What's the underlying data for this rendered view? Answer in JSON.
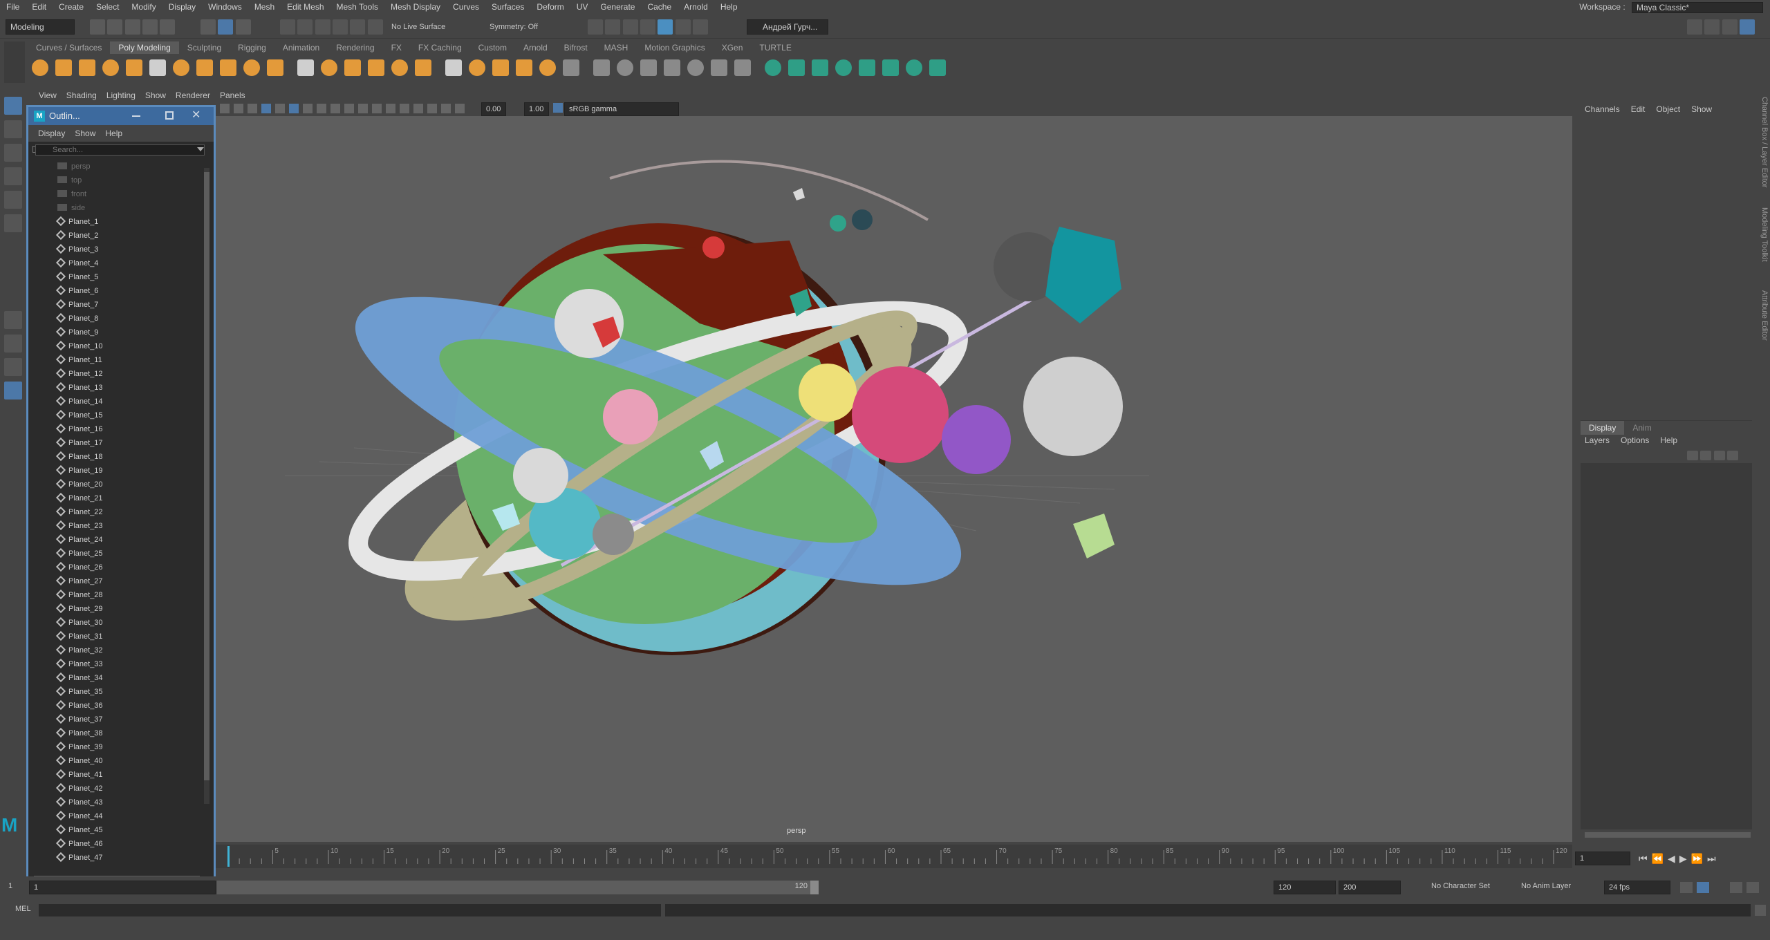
{
  "menubar": {
    "items": [
      "File",
      "Edit",
      "Create",
      "Select",
      "Modify",
      "Display",
      "Windows",
      "Mesh",
      "Edit Mesh",
      "Mesh Tools",
      "Mesh Display",
      "Curves",
      "Surfaces",
      "Deform",
      "UV",
      "Generate",
      "Cache",
      "Arnold",
      "Help"
    ],
    "workspace_label": "Workspace :",
    "workspace_value": "Maya Classic*"
  },
  "statusline": {
    "menuset": "Modeling",
    "live_surface": "No Live Surface",
    "symmetry": "Symmetry: Off",
    "user": "Андрей Гурч..."
  },
  "shelf": {
    "tabs": [
      "Curves / Surfaces",
      "Poly Modeling",
      "Sculpting",
      "Rigging",
      "Animation",
      "Rendering",
      "FX",
      "FX Caching",
      "Custom",
      "Arnold",
      "Bifrost",
      "MASH",
      "Motion Graphics",
      "XGen",
      "TURTLE"
    ],
    "active_tab": "Poly Modeling"
  },
  "outliner": {
    "title": "Outlin...",
    "menu": [
      "Display",
      "Show",
      "Help"
    ],
    "search_placeholder": "Search...",
    "cameras": [
      "persp",
      "top",
      "front",
      "side"
    ],
    "items": [
      "Planet_1",
      "Planet_2",
      "Planet_3",
      "Planet_4",
      "Planet_5",
      "Planet_6",
      "Planet_7",
      "Planet_8",
      "Planet_9",
      "Planet_10",
      "Planet_11",
      "Planet_12",
      "Planet_13",
      "Planet_14",
      "Planet_15",
      "Planet_16",
      "Planet_17",
      "Planet_18",
      "Planet_19",
      "Planet_20",
      "Planet_21",
      "Planet_22",
      "Planet_23",
      "Planet_24",
      "Planet_25",
      "Planet_26",
      "Planet_27",
      "Planet_28",
      "Planet_29",
      "Planet_30",
      "Planet_31",
      "Planet_32",
      "Planet_33",
      "Planet_34",
      "Planet_35",
      "Planet_36",
      "Planet_37",
      "Planet_38",
      "Planet_39",
      "Planet_40",
      "Planet_41",
      "Planet_42",
      "Planet_43",
      "Planet_44",
      "Planet_45",
      "Planet_46",
      "Planet_47"
    ]
  },
  "viewport": {
    "menu": [
      "View",
      "Shading",
      "Lighting",
      "Show",
      "Renderer",
      "Panels"
    ],
    "field_a": "0.00",
    "field_b": "1.00",
    "color_space": "sRGB gamma",
    "camera_label": "persp"
  },
  "timeline": {
    "ticks": [
      "5",
      "10",
      "15",
      "20",
      "25",
      "30",
      "35",
      "40",
      "45",
      "50",
      "55",
      "60",
      "65",
      "70",
      "75",
      "80",
      "85",
      "90",
      "95",
      "100",
      "105",
      "110",
      "115",
      "120"
    ],
    "current_frame": "1"
  },
  "range": {
    "start": "1",
    "range_start": "1",
    "range_handle": "120",
    "range_end": "120",
    "anim_end": "200",
    "character_set": "No Character Set",
    "anim_layer": "No Anim Layer",
    "fps": "24 fps"
  },
  "cmdline": {
    "label": "MEL"
  },
  "channelbox": {
    "menu": [
      "Channels",
      "Edit",
      "Object",
      "Show"
    ],
    "tabs": [
      "Display",
      "Anim"
    ],
    "layer_menu": [
      "Layers",
      "Options",
      "Help"
    ]
  },
  "side_tabs": [
    "Channel Box / Layer Editor",
    "Modeling Toolkit",
    "Attribute Editor"
  ],
  "colors": {
    "accent": "#5b8bbd",
    "shelf_icon": "#e39a3a",
    "viewport_bg": "#5e5e5e"
  }
}
